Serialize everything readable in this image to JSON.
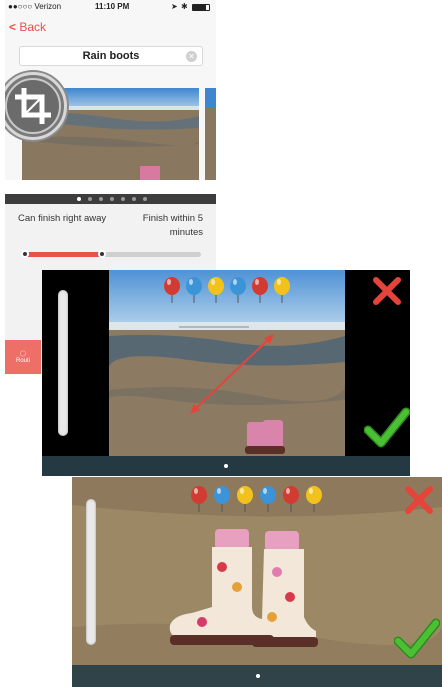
{
  "colors": {
    "accent": "#e8524b",
    "reject": "#e5443a",
    "accept": "#3dae2b",
    "sky": "#5f9fd8",
    "sand": "#9a8565"
  },
  "status_bar": {
    "carrier": "●●○○○ Verizon",
    "time": "11:10 PM",
    "icons": [
      "wifi-icon",
      "location-icon",
      "bluetooth-icon",
      "battery-icon"
    ]
  },
  "nav": {
    "back_label": "Back"
  },
  "search": {
    "value": "Rain boots",
    "clear_icon": "clear-icon"
  },
  "crop_tool": {
    "icon": "crop-icon"
  },
  "settings": {
    "left_label": "Can finish right away",
    "right_label": "Finish within 5 minutes",
    "page_count": 7,
    "active_page": 1,
    "slider_fraction": 0.44,
    "routine_tab_label": "Routi"
  },
  "game": {
    "balloon_colors": [
      "#d23b32",
      "#3b93d8",
      "#f2c21c",
      "#3b93d8",
      "#d23b32",
      "#f2c21c"
    ],
    "reject_icon": "close-x-icon",
    "accept_icon": "checkmark-icon",
    "page_indicator_count": 1
  }
}
